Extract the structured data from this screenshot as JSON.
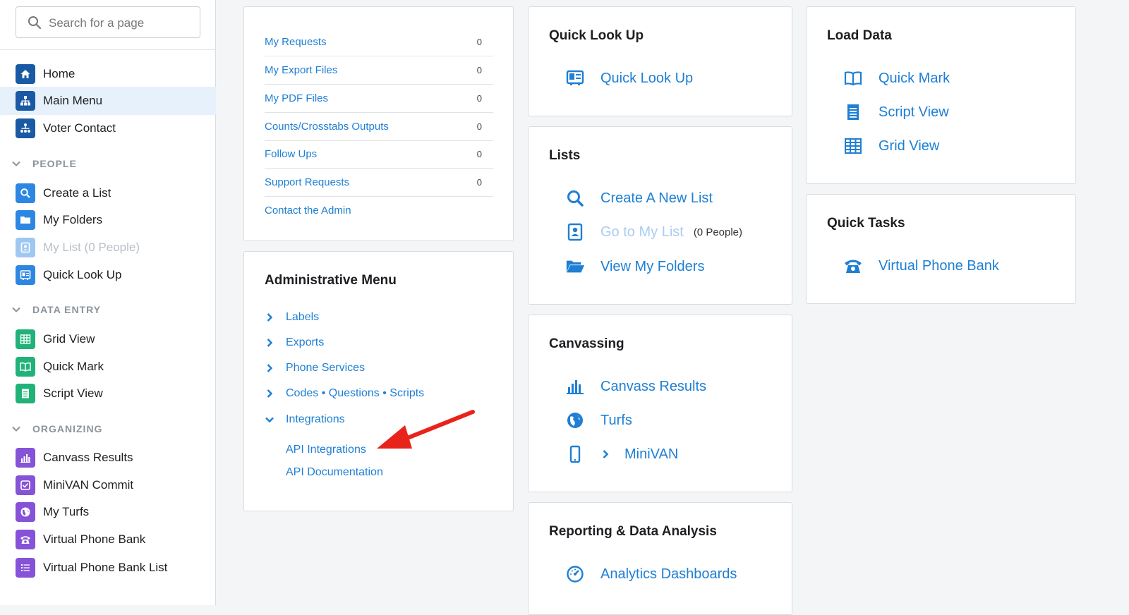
{
  "sidebar": {
    "search_placeholder": "Search for a page",
    "top_items": [
      {
        "label": "Home",
        "icon": "home-icon"
      },
      {
        "label": "Main Menu",
        "icon": "sitemap-icon",
        "active": true
      },
      {
        "label": "Voter Contact",
        "icon": "people-tree-icon"
      }
    ],
    "sections": [
      {
        "title": "PEOPLE",
        "items": [
          {
            "label": "Create a List",
            "icon": "search-icon"
          },
          {
            "label": "My Folders",
            "icon": "folder-icon"
          },
          {
            "label": "My List (0 People)",
            "icon": "contact-card-icon",
            "disabled": true
          },
          {
            "label": "Quick Look Up",
            "icon": "id-card-icon"
          }
        ]
      },
      {
        "title": "DATA ENTRY",
        "items": [
          {
            "label": "Grid View",
            "icon": "grid-icon"
          },
          {
            "label": "Quick Mark",
            "icon": "book-icon"
          },
          {
            "label": "Script View",
            "icon": "document-icon"
          }
        ]
      },
      {
        "title": "ORGANIZING",
        "items": [
          {
            "label": "Canvass Results",
            "icon": "bar-chart-icon"
          },
          {
            "label": "MiniVAN Commit",
            "icon": "checkbox-icon"
          },
          {
            "label": "My Turfs",
            "icon": "globe-icon"
          },
          {
            "label": "Virtual Phone Bank",
            "icon": "phone-icon"
          },
          {
            "label": "Virtual Phone Bank List",
            "icon": "list-icon"
          }
        ]
      }
    ]
  },
  "requests_card": {
    "rows": [
      {
        "label": "My Requests",
        "count": "0"
      },
      {
        "label": "My Export Files",
        "count": "0"
      },
      {
        "label": "My PDF Files",
        "count": "0"
      },
      {
        "label": "Counts/Crosstabs Outputs",
        "count": "0"
      },
      {
        "label": "Follow Ups",
        "count": "0"
      },
      {
        "label": "Support Requests",
        "count": "0"
      },
      {
        "label": "Contact the Admin",
        "count": ""
      }
    ]
  },
  "admin_card": {
    "title": "Administrative Menu",
    "items": [
      "Labels",
      "Exports",
      "Phone Services",
      "Codes • Questions • Scripts",
      "Integrations"
    ],
    "sub_items": [
      "API Integrations",
      "API Documentation"
    ]
  },
  "quick_lookup_card": {
    "title": "Quick Look Up",
    "links": [
      {
        "label": "Quick Look Up",
        "icon": "id-card-icon"
      }
    ]
  },
  "lists_card": {
    "title": "Lists",
    "links": [
      {
        "label": "Create A New List",
        "icon": "search-icon"
      },
      {
        "label": "Go to My List",
        "icon": "contact-card-icon",
        "disabled": true,
        "note": "(0 People)"
      },
      {
        "label": "View My Folders",
        "icon": "folder-open-icon"
      }
    ]
  },
  "canvassing_card": {
    "title": "Canvassing",
    "links": [
      {
        "label": "Canvass Results",
        "icon": "bar-chart-icon"
      },
      {
        "label": "Turfs",
        "icon": "globe-icon"
      },
      {
        "label": "MiniVAN",
        "icon": "mobile-phone-icon"
      }
    ]
  },
  "reporting_card": {
    "title": "Reporting & Data Analysis",
    "links": [
      {
        "label": "Analytics Dashboards",
        "icon": "dashboard-gauge-icon"
      }
    ]
  },
  "load_data_card": {
    "title": "Load Data",
    "links": [
      {
        "label": "Quick Mark",
        "icon": "book-icon"
      },
      {
        "label": "Script View",
        "icon": "document-icon"
      },
      {
        "label": "Grid View",
        "icon": "grid-icon"
      }
    ]
  },
  "quick_tasks_card": {
    "title": "Quick Tasks",
    "links": [
      {
        "label": "Virtual Phone Bank",
        "icon": "phone-icon"
      }
    ]
  },
  "colors": {
    "link": "#1e7fd4",
    "annotation_arrow": "#e8231c",
    "sidebar_active": "#e6f1fb"
  }
}
